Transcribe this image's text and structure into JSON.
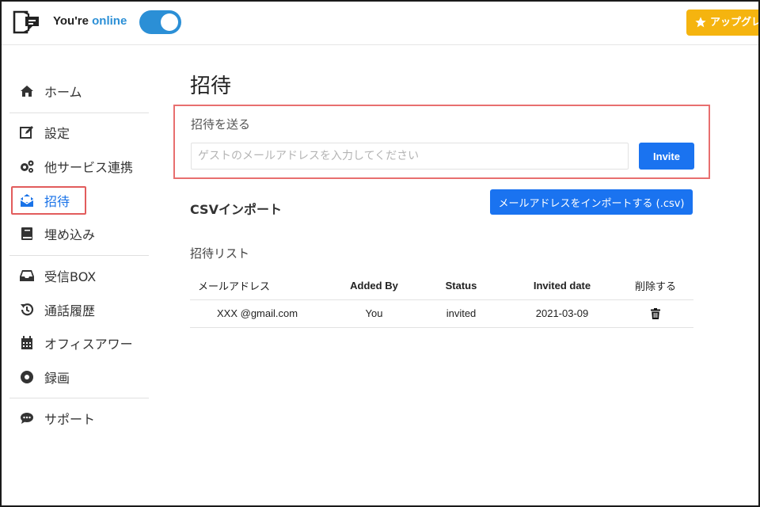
{
  "topbar": {
    "status_prefix": "You're",
    "status_word": "online",
    "toggle_on": true,
    "upgrade_label": "アップグレ"
  },
  "sidebar": {
    "items": [
      {
        "label": "ホーム",
        "icon": "home-icon"
      },
      {
        "label": "設定",
        "icon": "edit-icon"
      },
      {
        "label": "他サービス連携",
        "icon": "gears-icon"
      },
      {
        "label": "招待",
        "icon": "envelope-open-icon"
      },
      {
        "label": "埋め込み",
        "icon": "book-icon"
      },
      {
        "label": "受信BOX",
        "icon": "inbox-icon"
      },
      {
        "label": "通話履歴",
        "icon": "history-icon"
      },
      {
        "label": "オフィスアワー",
        "icon": "calendar-icon"
      },
      {
        "label": "録画",
        "icon": "record-icon"
      },
      {
        "label": "サポート",
        "icon": "comment-dots-icon"
      }
    ],
    "active_index": 3
  },
  "main": {
    "title": "招待",
    "invite": {
      "label": "招待を送る",
      "placeholder": "ゲストのメールアドレスを入力してください",
      "button": "Invite"
    },
    "csv": {
      "label": "CSVインポート",
      "button": "メールアドレスをインポートする (.csv)"
    },
    "list": {
      "label": "招待リスト",
      "columns": [
        "メールアドレス",
        "Added By",
        "Status",
        "Invited date",
        "削除する"
      ],
      "rows": [
        {
          "email": "XXX @gmail.com",
          "added_by": "You",
          "status": "invited",
          "invited_date": "2021-03-09"
        }
      ]
    }
  },
  "colors": {
    "accent": "#1a73f0",
    "online": "#2b8fd6",
    "upgrade": "#f5b40f",
    "highlight": "#e86f6f"
  }
}
